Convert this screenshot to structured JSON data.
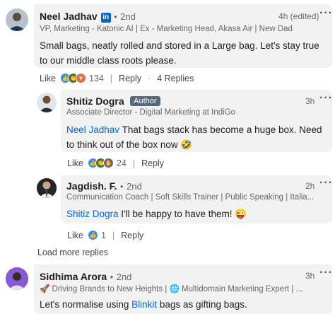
{
  "comments": [
    {
      "author": "Neel Jadhav",
      "degree": "2nd",
      "headline": "VP, Marketing - Katonic AI | Ex - Marketing Head, Akasa Air | New Dad",
      "time": "4h (edited)",
      "text": "Small bags, neatly rolled and stored in a Large bag. Let's stay true to our middle class roots please.",
      "like_label": "Like",
      "reaction_count": "134",
      "reply_label": "Reply",
      "replies_label": "4 Replies"
    },
    {
      "author": "Shitiz Dogra",
      "author_badge": "Author",
      "headline": "Associate Director - Digital Marketing at IndiGo",
      "time": "3h",
      "mention": "Neel Jadhav",
      "text": " That bags stack has become a huge box. Need to think out of the box now 🤣",
      "like_label": "Like",
      "reaction_count": "24",
      "reply_label": "Reply"
    },
    {
      "author": "Jagdish. F.",
      "degree": "2nd",
      "headline": "Communication Coach | Soft Skills Trainer | Public Speaking | Italia...",
      "time": "2h",
      "mention": "Shitiz Dogra",
      "text": " I'll be happy to have them! 😜",
      "like_label": "Like",
      "reaction_count": "1",
      "reply_label": "Reply"
    },
    {
      "author": "Sidhima Arora",
      "degree": "2nd",
      "headline": "🚀 Driving Brands to New Heights | 🌐 Multidomain Marketing Expert | ...",
      "time": "3h",
      "text_before": "Let's normalise using ",
      "mention": "Blinkit",
      "text_after": " bags as gifting bags."
    }
  ],
  "load_more_label": "Load more replies",
  "colors": {
    "link": "#0a66c2",
    "bubble": "#f2f2f2",
    "like_blue": "#378fe9",
    "celebrate_green": "#44712e",
    "love_red": "#df704d",
    "support_purple": "#715e86"
  }
}
